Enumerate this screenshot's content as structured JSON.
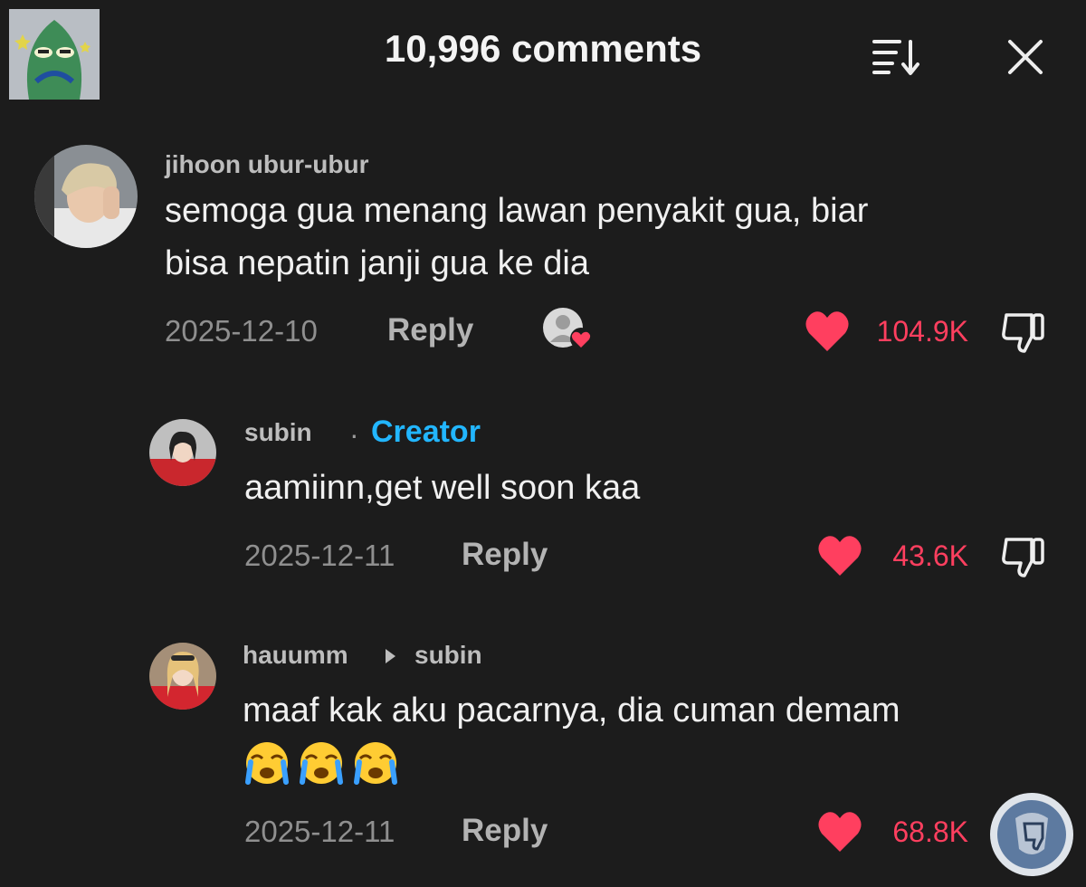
{
  "header": {
    "title": "10,996 comments",
    "sort_icon": "sort-icon",
    "close_icon": "close-icon"
  },
  "comments": [
    {
      "username": "jihoon ubur-ubur",
      "lines": [
        "semoga gua menang lawan penyakit gua, biar",
        "bisa nepatin janji gua ke dia"
      ],
      "date": "2025-12-10",
      "reply_label": "Reply",
      "likes": "104.9K",
      "creator_liked_icon": "creator-liked-heart-icon"
    },
    {
      "username": "subin",
      "badge_separator": "·",
      "badge": "Creator",
      "lines": [
        "aamiinn,get well soon kaa"
      ],
      "date": "2025-12-11",
      "reply_label": "Reply",
      "likes": "43.6K"
    },
    {
      "username": "hauumm",
      "reply_to": "subin",
      "lines": [
        "maaf kak aku pacarnya, dia cuman demam"
      ],
      "emoji": [
        "😭",
        "😭",
        "😭"
      ],
      "date": "2025-12-11",
      "reply_label": "Reply",
      "likes": "68.8K"
    }
  ],
  "colors": {
    "background": "#1c1c1c",
    "like_red": "#ff3f5f",
    "creator_blue": "#22b6ff"
  }
}
